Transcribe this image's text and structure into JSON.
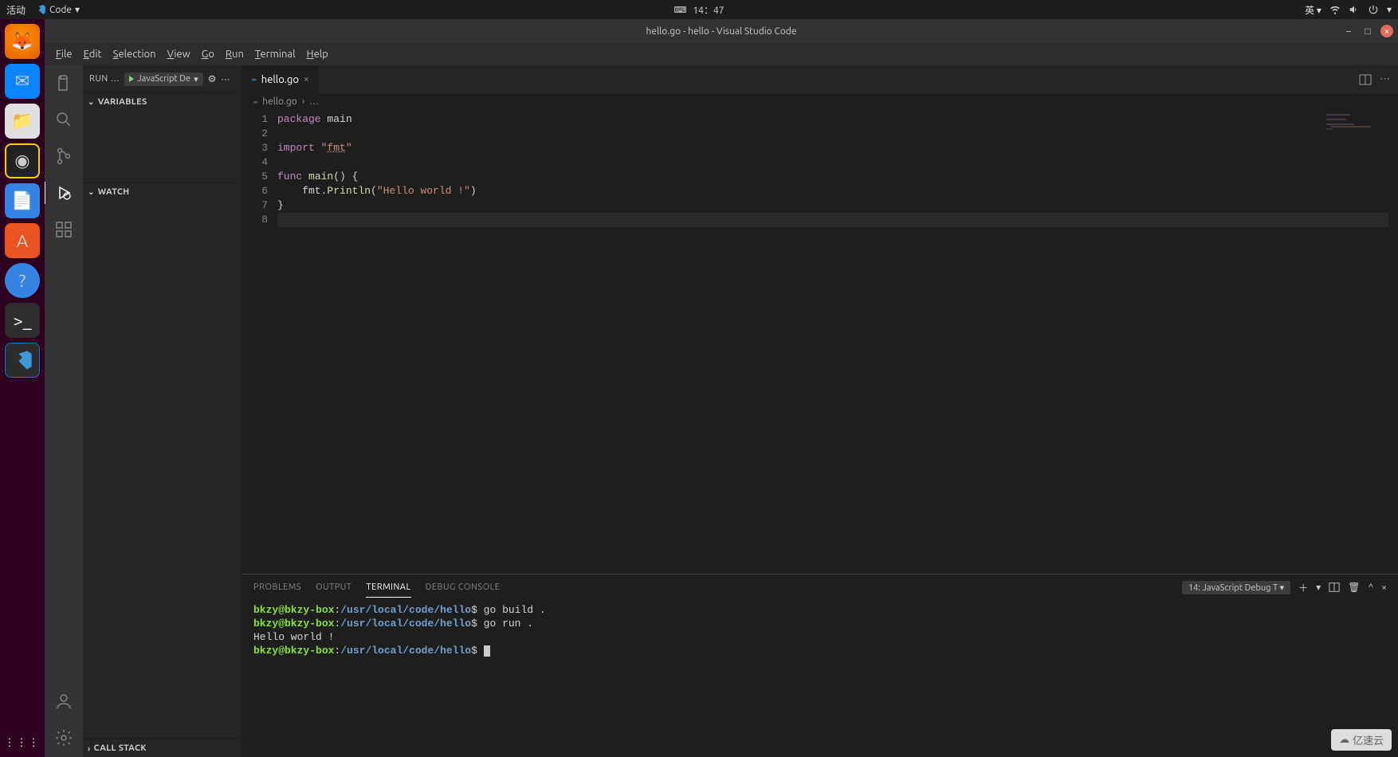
{
  "system": {
    "activities": "活动",
    "appmenu": "Code",
    "time": "14：47",
    "lang": "英"
  },
  "titlebar": "hello.go - hello - Visual Studio Code",
  "menu": {
    "file": "File",
    "edit": "Edit",
    "selection": "Selection",
    "view": "View",
    "go": "Go",
    "run": "Run",
    "terminal": "Terminal",
    "help": "Help"
  },
  "run_panel": {
    "label": "RUN …",
    "config": "JavaScript De",
    "sections": {
      "variables": "VARIABLES",
      "watch": "WATCH",
      "callstack": "CALL STACK"
    }
  },
  "tab": {
    "name": "hello.go"
  },
  "breadcrumb": {
    "file": "hello.go",
    "rest": "…"
  },
  "code": {
    "lines": [
      "1",
      "2",
      "3",
      "4",
      "5",
      "6",
      "7",
      "8"
    ],
    "l1_kw": "package",
    "l1_id": " main",
    "l3_kw": "import",
    "l3_q1": " \"",
    "l3_pkg": "fmt",
    "l3_q2": "\"",
    "l5_kw": "func",
    "l5_fn": " main",
    "l5_rest": "() {",
    "l6_indent": "    fmt.",
    "l6_fn": "Println",
    "l6_paren": "(",
    "l6_str": "\"Hello world !\"",
    "l6_close": ")",
    "l7": "}"
  },
  "panel": {
    "tabs": {
      "problems": "PROBLEMS",
      "output": "OUTPUT",
      "terminal": "TERMINAL",
      "debug": "DEBUG CONSOLE"
    },
    "term_selector": "14: JavaScript Debug T",
    "term": {
      "user": "bkzy@bkzy-box",
      "path": "/usr/local/code/hello",
      "cmd1": " go build .",
      "cmd2": " go run .",
      "out": "Hello world !"
    }
  },
  "watermark": "亿速云"
}
